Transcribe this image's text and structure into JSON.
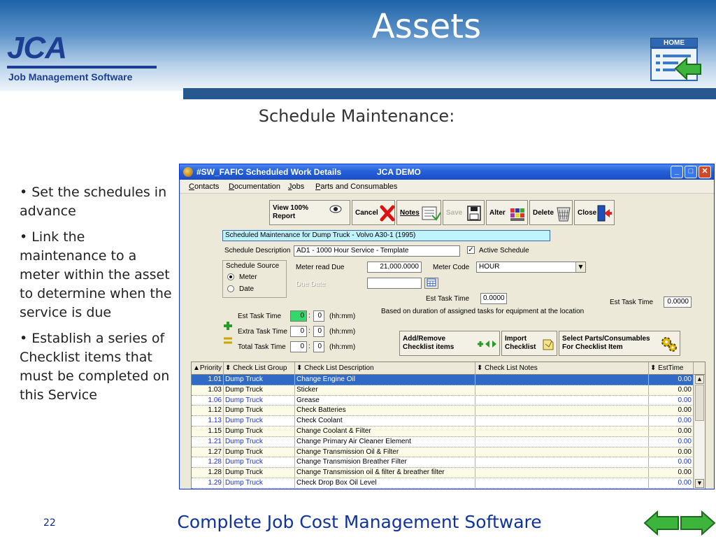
{
  "slide": {
    "title": "Assets",
    "logo_text": "JCA",
    "tagline": "Job Management Software",
    "home_label": "HOME",
    "subtitle": "Schedule Maintenance:",
    "bullets": [
      "• Set the schedules in advance",
      "• Link the maintenance to a meter within the asset to determine when the service is due",
      "• Establish a series of Checklist items that must  be completed on this Service"
    ],
    "page_number": "22",
    "footer": "Complete Job Cost Management Software",
    "colors": {
      "title_band": "#1e63a8",
      "brand": "#1b3f93",
      "footer_text": "#10349b",
      "nav_green": "#3db53d"
    }
  },
  "window": {
    "title": "#SW_FAFIC Scheduled Work Details",
    "title_right": "JCA DEMO",
    "controls": [
      "minimize",
      "maximize",
      "close"
    ],
    "menu": [
      "Contacts",
      "Documentation",
      "Jobs",
      "Parts and Consumables"
    ],
    "toolbar": {
      "view_report": "View 100% Report",
      "cancel": "Cancel",
      "notes": "Notes",
      "save": "Save",
      "alter": "Alter",
      "delete": "Delete",
      "close": "Close"
    },
    "form": {
      "asset_name": "Scheduled Maintenance for Dump Truck - Volvo A30-1  (1995)",
      "schedule_description_label": "Schedule Description",
      "schedule_description": "AD1 - 1000 Hour Service - Template",
      "active_schedule_label": "Active Schedule",
      "active_schedule_checked": true,
      "schedule_source_label": "Schedule Source",
      "source_options": [
        "Meter",
        "Date"
      ],
      "source_selected": "Meter",
      "meter_read_due_label": "Meter read Due",
      "meter_read_due": "21,000.0000",
      "meter_code_label": "Meter Code",
      "meter_code": "HOUR",
      "due_date_label": "Due Date",
      "due_date": "",
      "est_task_time_label": "Est Task Time",
      "est_task_time_mid": "0.0000",
      "est_task_time_right": "0.0000",
      "based_on_note": "Based on duration of assigned tasks for equipment at the location",
      "est_task_time_hours": "0",
      "est_task_time_mins": "0",
      "extra_task_time_label": "Extra Task Time",
      "extra_task_time_hours": "0",
      "extra_task_time_mins": "0",
      "total_task_time_label": "Total Task Time",
      "total_task_time_hours": "0",
      "total_task_time_mins": "0",
      "hhmm": "(hh:mm)",
      "colon": ":",
      "add_remove_label": "Add/Remove Checklist items",
      "import_label": "Import Checklist",
      "select_parts_label": "Select Parts/Consumables For Checklist Item"
    },
    "grid": {
      "columns": [
        "Priority",
        "Check List Group",
        "Check List Description",
        "Check List Notes",
        "EstTime"
      ],
      "rows": [
        {
          "priority": "1.01",
          "group": "Dump Truck",
          "description": "Change Engine Oil",
          "notes": "",
          "est": "0.00",
          "selected": true,
          "blue": false
        },
        {
          "priority": "1.03",
          "group": "Dump Truck",
          "description": "Sticker",
          "notes": "",
          "est": "0.00",
          "selected": false,
          "blue": false
        },
        {
          "priority": "1.06",
          "group": "Dump Truck",
          "description": "Grease",
          "notes": "",
          "est": "0.00",
          "selected": false,
          "blue": true
        },
        {
          "priority": "1.12",
          "group": "Dump Truck",
          "description": "Check Batteries",
          "notes": "",
          "est": "0.00",
          "selected": false,
          "blue": false
        },
        {
          "priority": "1.13",
          "group": "Dump Truck",
          "description": "Check Coolant",
          "notes": "",
          "est": "0.00",
          "selected": false,
          "blue": true
        },
        {
          "priority": "1.15",
          "group": "Dump Truck",
          "description": "Change Coolant & Filter",
          "notes": "",
          "est": "0.00",
          "selected": false,
          "blue": false
        },
        {
          "priority": "1.21",
          "group": "Dump Truck",
          "description": "Change Primary Air Cleaner  Element",
          "notes": "",
          "est": "0.00",
          "selected": false,
          "blue": true
        },
        {
          "priority": "1.27",
          "group": "Dump Truck",
          "description": "Change Transmission Oil & Filter",
          "notes": "",
          "est": "0.00",
          "selected": false,
          "blue": false
        },
        {
          "priority": "1.28",
          "group": "Dump Truck",
          "description": "Change Transmision Breather Filter",
          "notes": "",
          "est": "0.00",
          "selected": false,
          "blue": true
        },
        {
          "priority": "1.28",
          "group": "Dump Truck",
          "description": "Change Transmission oil & filter & breather filter",
          "notes": "",
          "est": "0.00",
          "selected": false,
          "blue": false
        },
        {
          "priority": "1.29",
          "group": "Dump Truck",
          "description": "Check Drop Box Oil Level",
          "notes": "",
          "est": "0.00",
          "selected": false,
          "blue": true
        }
      ]
    }
  }
}
